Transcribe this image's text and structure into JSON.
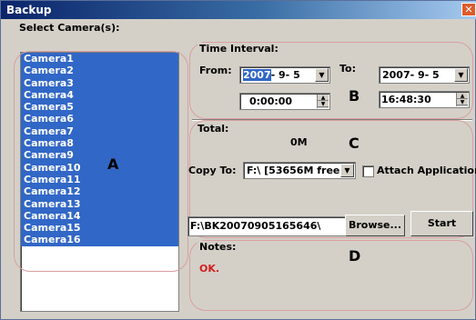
{
  "window": {
    "title": "Backup",
    "close_glyph": "✕"
  },
  "select_cameras": {
    "label": "Select Camera(s):",
    "items": [
      "Camera1",
      "Camera2",
      "Camera3",
      "Camera4",
      "Camera5",
      "Camera6",
      "Camera7",
      "Camera8",
      "Camera9",
      "Camera10",
      "Camera11",
      "Camera12",
      "Camera13",
      "Camera14",
      "Camera15",
      "Camera16"
    ]
  },
  "time_interval": {
    "label": "Time Interval:",
    "from_label": "From:",
    "to_label": "To:",
    "from_date_sel": "2007",
    "from_date_rest": "- 9- 5",
    "from_time": "0:00:00",
    "to_date": "2007- 9- 5",
    "to_time": "16:48:30"
  },
  "total": {
    "label": "Total:",
    "value": "0M"
  },
  "copy": {
    "label": "Copy To:",
    "drive": "F:\\ [53656M free]",
    "attach_label": "Attach Application",
    "attach_checked": false,
    "path": "F:\\BK20070905165646\\",
    "browse_label": "Browse...",
    "start_label": "Start"
  },
  "notes": {
    "label": "Notes:",
    "text": "OK."
  },
  "annotations": {
    "a": "A",
    "b": "B",
    "c": "C",
    "d": "D"
  },
  "colors": {
    "selection": "#3167c6",
    "status": "#d02020",
    "annotation_ring": "#d9a0a0"
  },
  "icons": {
    "dropdown": "chevron-down-icon",
    "spin_up": "chevron-up-icon",
    "spin_down": "chevron-down-icon"
  }
}
